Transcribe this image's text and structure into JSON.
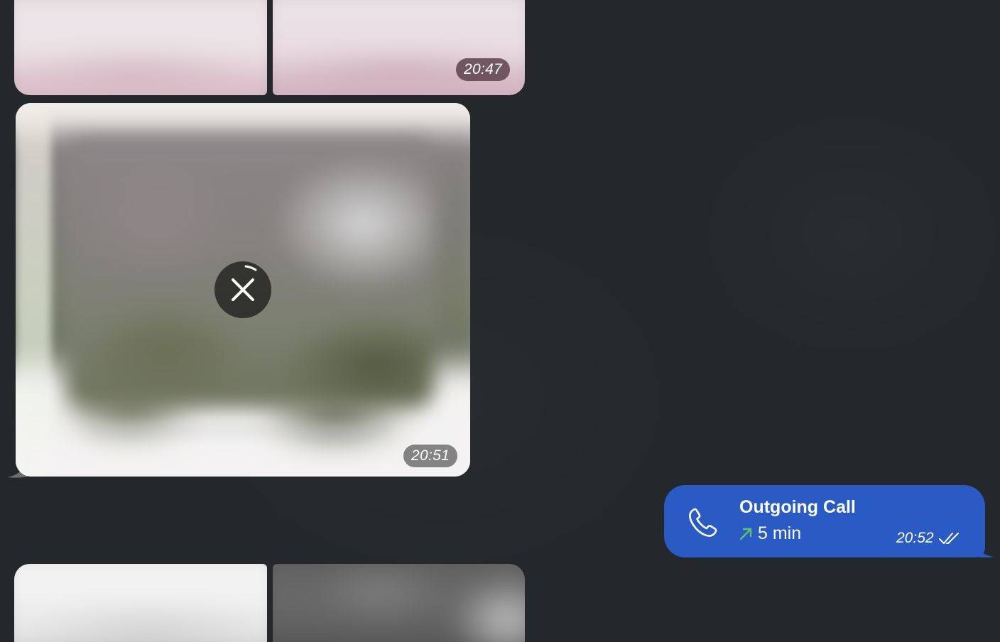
{
  "messages": {
    "album_top": {
      "time": "20:47"
    },
    "media": {
      "time": "20:51",
      "action_icon": "close-icon"
    },
    "call": {
      "title": "Outgoing Call",
      "duration": "5 min",
      "time": "20:52",
      "status_icon": "double-check-icon",
      "direction_icon": "outgoing-arrow-icon",
      "accent_color": "#2a5bc4",
      "arrow_color": "#5fc46a"
    }
  },
  "colors": {
    "background": "#25282b"
  }
}
